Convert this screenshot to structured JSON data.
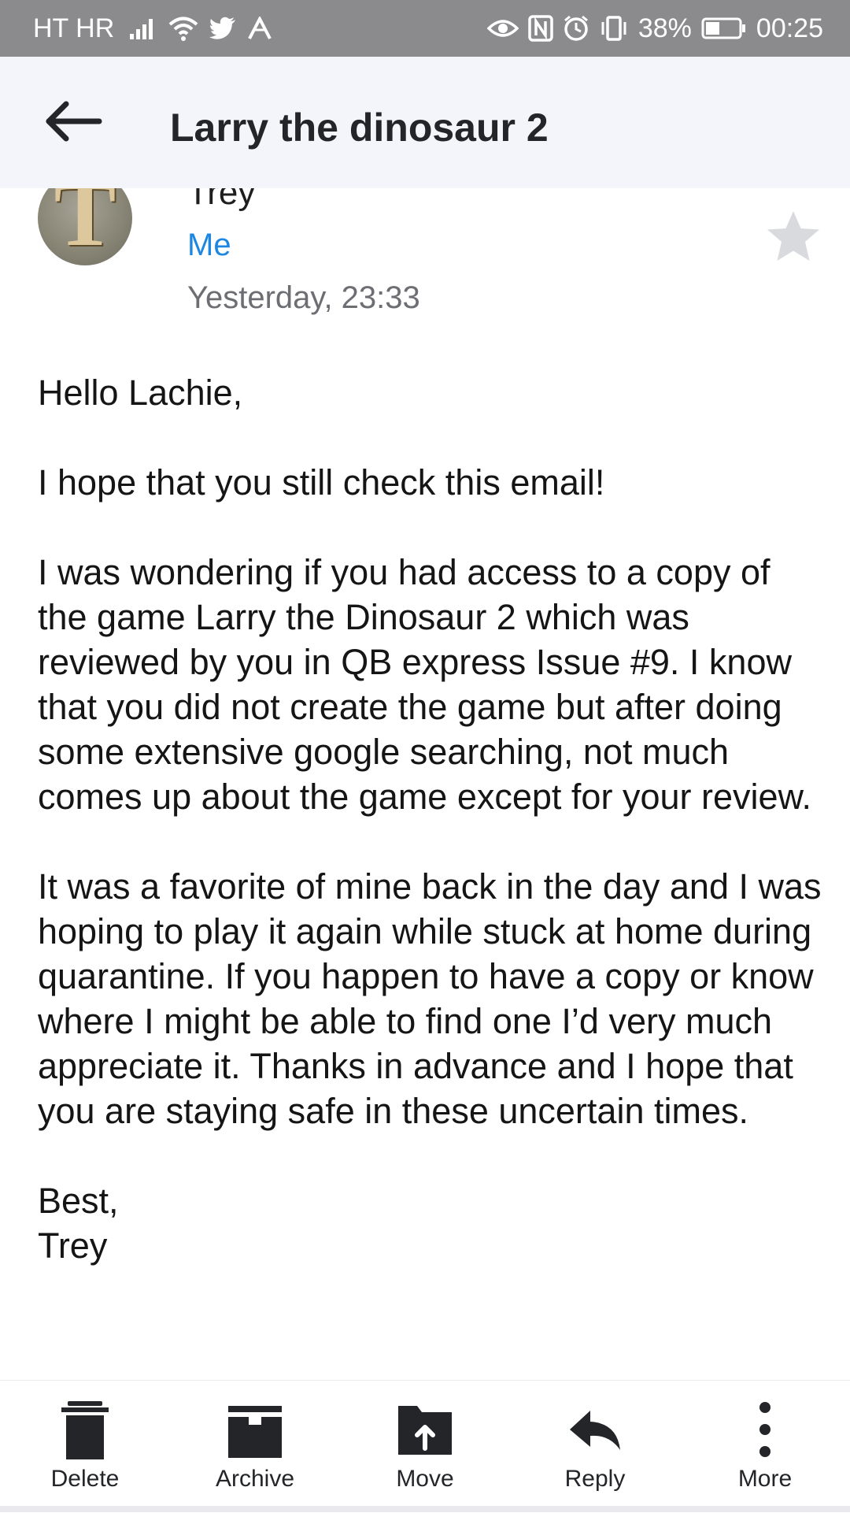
{
  "status_bar": {
    "carrier": "HT HR",
    "battery_percent": "38%",
    "time": "00:25",
    "icons": [
      "signal-icon",
      "wifi-icon",
      "twitter-icon",
      "app-icon",
      "eye-icon",
      "nfc-icon",
      "alarm-icon",
      "vibrate-icon",
      "battery-icon"
    ]
  },
  "header": {
    "back_icon": "back-arrow-icon",
    "title": "Larry the dinosaur 2"
  },
  "email": {
    "avatar_letter": "T",
    "sender": "Trey",
    "recipient": "Me",
    "timestamp": "Yesterday, 23:33",
    "starred": false,
    "body": {
      "greeting": "Hello Lachie,",
      "paragraphs": [
        "I hope that you still check this email!",
        "I was wondering if you had access to a copy of the game Larry the Dinosaur 2 which was reviewed by you in QB express Issue #9. I know that you did not create the game but after doing some extensive google searching, not much comes up about the game except for your review.",
        "It was a favorite of mine back in the day and I was hoping to play it again while stuck at home during quarantine. If you happen to have a copy or know where I might be able to find one I’d very much appreciate it. Thanks in advance and I hope that you are staying safe in these uncertain times."
      ],
      "signoff": "Best,",
      "signature": "Trey"
    }
  },
  "toolbar": {
    "delete_label": "Delete",
    "archive_label": "Archive",
    "move_label": "Move",
    "reply_label": "Reply",
    "more_label": "More"
  },
  "colors": {
    "status_bar": "#8b8b8d",
    "header_bg": "#f4f5fa",
    "accent_link": "#1c86e2",
    "icon_dark": "#232529"
  }
}
